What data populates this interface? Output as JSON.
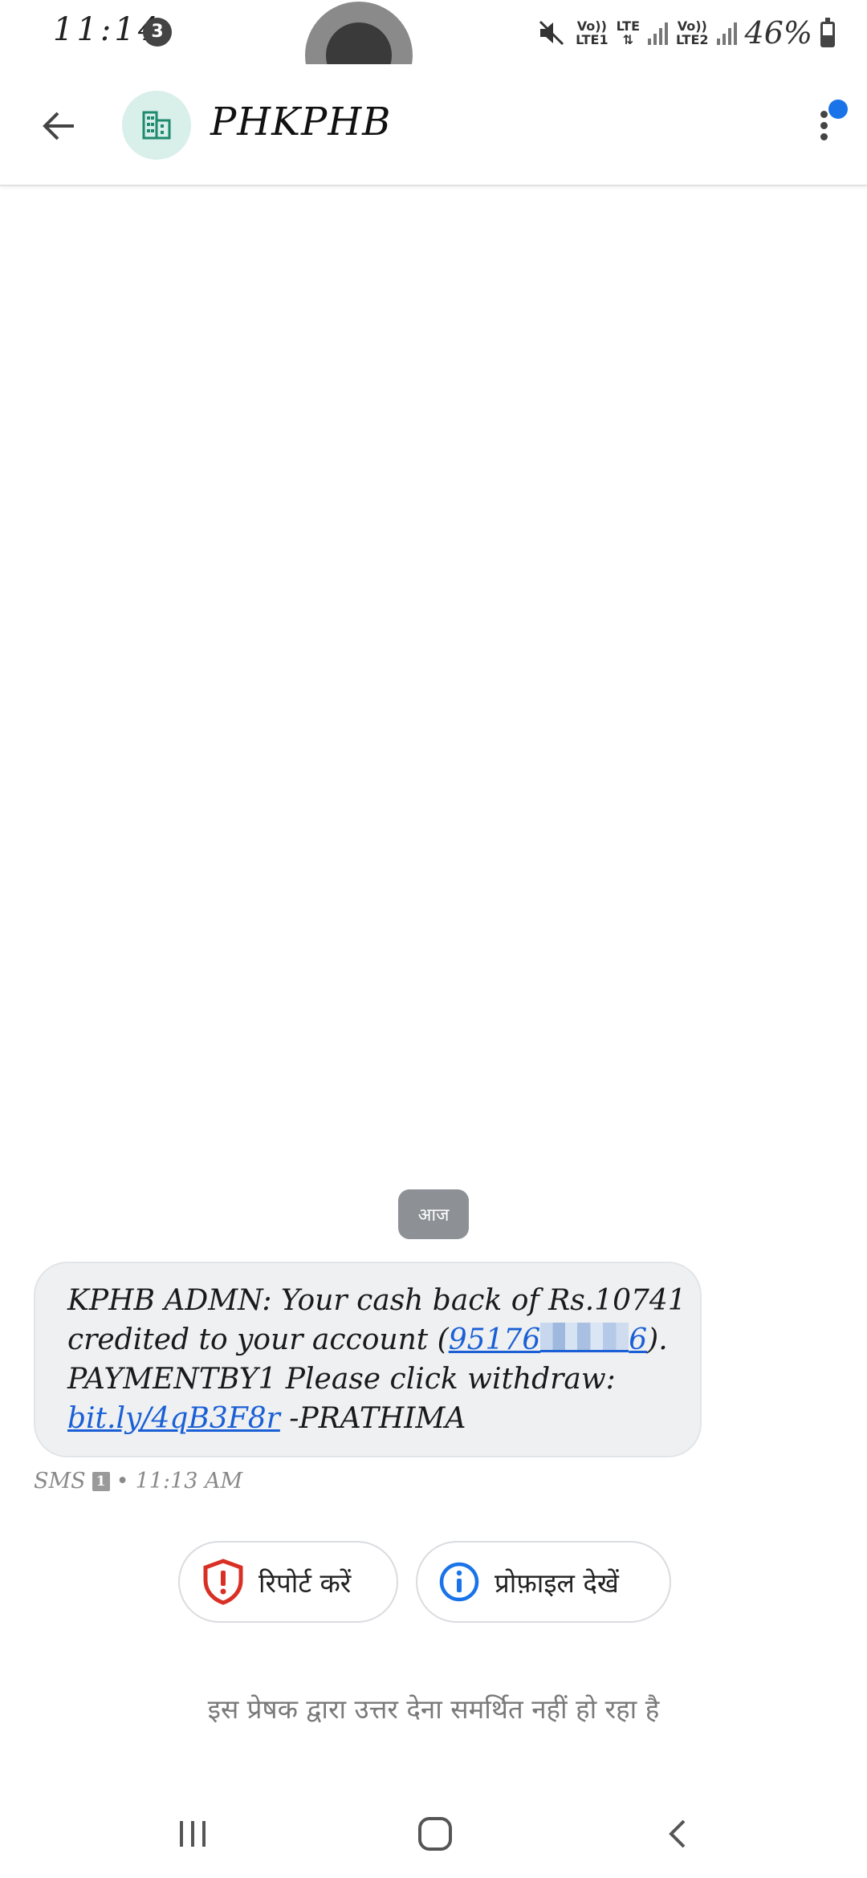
{
  "status_bar": {
    "time": "11:14",
    "notification_count": "3",
    "sim1_label_top": "Vo))",
    "sim1_label_bottom": "LTE1",
    "lte_label": "LTE",
    "sim2_label_top": "Vo))",
    "sim2_label_bottom": "LTE2",
    "battery_percent": "46%",
    "battery_level": 0.46
  },
  "header": {
    "title": "PHKPHB",
    "avatar_icon": "business-building-icon",
    "avatar_bg_color": "#d9efea",
    "avatar_icon_color": "#1e8a6e",
    "menu_badge_color": "#1a73e8"
  },
  "conversation": {
    "date_chip": "आज",
    "message": {
      "line1": "KPHB ADMN: Your cash back of Rs.10741",
      "line2_prefix": "credited to your account (",
      "account_link_visible": "95176",
      "account_link_suffix": "6",
      "line2_suffix": ").",
      "line3": "PAYMENTBY1 Please click withdraw:",
      "short_link": "bit.ly/4qB3F8r",
      "line4_suffix": " -PRATHIMA"
    },
    "meta": {
      "type": "SMS",
      "sim": "1",
      "separator": "•",
      "time": "11:13 AM"
    }
  },
  "actions": {
    "report_label": "रिपोर्ट करें",
    "report_icon": "shield-alert-icon",
    "report_color": "#d93025",
    "profile_label": "प्रोफ़ाइल देखें",
    "profile_icon": "info-icon",
    "profile_color": "#1a73e8"
  },
  "footer": {
    "note": "इस प्रेषक द्वारा उत्तर देना समर्थित नहीं हो रहा है"
  },
  "nav": {
    "recents_icon": "recents-icon",
    "home_icon": "home-icon",
    "back_icon": "back-chevron-icon"
  }
}
